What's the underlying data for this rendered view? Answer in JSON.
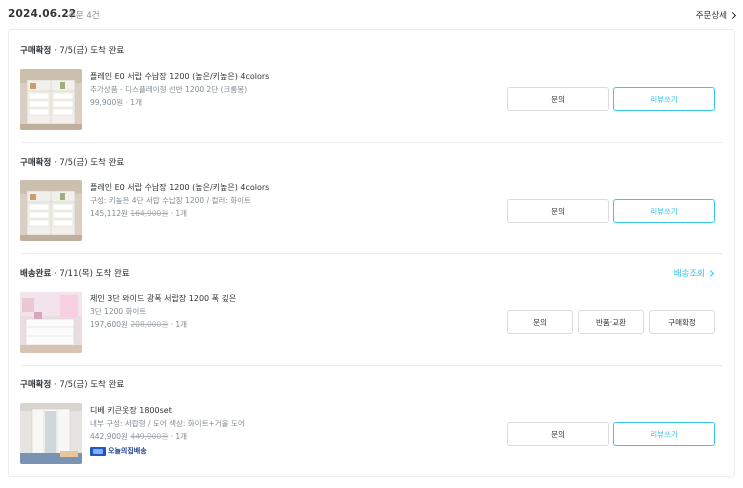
{
  "order": {
    "date": "2024.06.22",
    "count_label": "주문 4건",
    "detail_link": "주문상세"
  },
  "groups": [
    {
      "status_bold": "구매확정",
      "status_rest": " · 7/5(금) 도착 완료",
      "product": {
        "name": "플레인 E0 서랍 수납장 1200 (높은/키높은) 4colors",
        "option": "추가상품 - 디스플레이형 선반 1200 2단 (크롬봉)",
        "price": "99,900원",
        "original_price": "",
        "qty": " · 1개"
      },
      "buttons": [
        "문의",
        "리뷰쓰기"
      ]
    },
    {
      "status_bold": "구매확정",
      "status_rest": " · 7/5(금) 도착 완료",
      "product": {
        "name": "플레인 E0 서랍 수납장 1200 (높은/키높은) 4colors",
        "option": "구성: 키높은 4단 서랍 수납장 1200 / 컬러: 화이트",
        "price": "145,112원",
        "original_price": "164,900원",
        "qty": " · 1개"
      },
      "buttons": [
        "문의",
        "리뷰쓰기"
      ]
    },
    {
      "status_bold": "배송완료",
      "status_rest": " · 7/11(목) 도착 완료",
      "tracking_link": "배송조회",
      "product": {
        "name": "제인 3단 와이드 광폭 서랍장 1200 폭 깊은",
        "option": "3단 1200 화이트",
        "price": "197,600원",
        "original_price": "208,000원",
        "qty": " · 1개"
      },
      "buttons": [
        "문의",
        "반품·교환",
        "구매확정"
      ]
    },
    {
      "status_bold": "구매확정",
      "status_rest": " · 7/5(금) 도착 완료",
      "product": {
        "name": "디베 키큰옷장 1800set",
        "option": "내부 구성: 서랍형 / 도어 색상: 화이트+거울 도어",
        "price": "442,900원",
        "original_price": "449,900원",
        "qty": " · 1개",
        "delivery_badge": "오늘의집배송"
      },
      "buttons": [
        "문의",
        "리뷰쓰기"
      ]
    }
  ],
  "colors": {
    "accent": "#35c5f0",
    "text": "#2f3438",
    "muted": "#828c94",
    "border": "#dadce0"
  }
}
